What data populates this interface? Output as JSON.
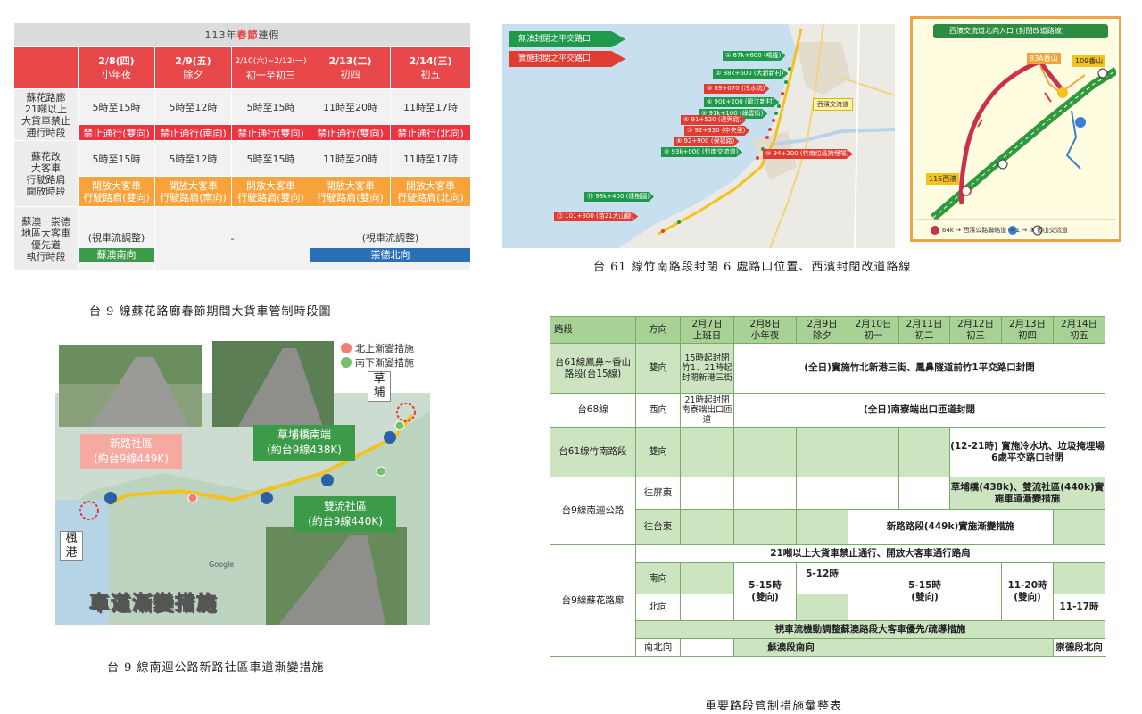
{
  "schedule": {
    "title_prefix": "113年",
    "title_highlight": "春節",
    "title_suffix": "連假",
    "days": [
      {
        "date": "2/8(四)",
        "name": "小年夜"
      },
      {
        "date": "2/9(五)",
        "name": "除夕"
      },
      {
        "date": "2/10(六)~2/12(一)",
        "name": "初一至初三"
      },
      {
        "date": "2/13(二)",
        "name": "初四"
      },
      {
        "date": "2/14(三)",
        "name": "初五"
      }
    ],
    "row1_label": "蘇花路廊\n21噸以上\n大貨車禁止\n通行時段",
    "row1_times": [
      "5時至15時",
      "5時至12時",
      "5時至15時",
      "11時至20時",
      "11時至17時"
    ],
    "row1_notes": [
      "禁止通行(雙向)",
      "禁止通行(南向)",
      "禁止通行(雙向)",
      "禁止通行(雙向)",
      "禁止通行(北向)"
    ],
    "row2_label": "蘇花改\n大客車\n行駛路肩\n開放時段",
    "row2_times": [
      "5時至15時",
      "5時至12時",
      "5時至15時",
      "11時至20時",
      "11時至17時"
    ],
    "row2_notes": [
      "開放大客車\n行駛路肩(雙向)",
      "開放大客車\n行駛路肩(南向)",
      "開放大客車\n行駛路肩(雙向)",
      "開放大客車\n行駛路肩(雙向)",
      "開放大客車\n行駛路肩(北向)"
    ],
    "row3_label": "蘇澳 · 崇德\n地區大客車\n優先道\n執行時段",
    "row3_left": "(視車流調整)",
    "row3_left_tag": "蘇澳南向",
    "row3_mid": "-",
    "row3_right": "(視車流調整)",
    "row3_right_tag": "崇德北向",
    "caption": "台 9 線蘇花路廊春節期間大貨車管制時段圖"
  },
  "map61": {
    "legend": [
      "無法封閉之平交路口",
      "實施封閉之平交路口"
    ],
    "sites": [
      {
        "label": "① 87k+600 (鳴隆)",
        "color": "g"
      },
      {
        "label": "② 88k+600 (大新新村)",
        "color": "g"
      },
      {
        "label": "③ 89+070 (冷水坑)",
        "color": "r"
      },
      {
        "label": "④ 90k+200 (龍江新村)",
        "color": "g"
      },
      {
        "label": "⑤ 91k+100 (綠雲街)",
        "color": "g"
      },
      {
        "label": "⑥ 91+520 (達興路)",
        "color": "r"
      },
      {
        "label": "⑦ 92+330 (中央里)",
        "color": "r"
      },
      {
        "label": "⑧ 92+900 (保福路)",
        "color": "r"
      },
      {
        "label": "⑨ 93k+000 (竹南交流道)",
        "color": "g"
      },
      {
        "label": "⑩ 94+200 (竹南垃圾掩埋場)",
        "color": "r"
      },
      {
        "label": "⑪ 98k+400 (達樹國)",
        "color": "g"
      },
      {
        "label": "⑫ 101+300 (苗21大山腳)",
        "color": "r"
      }
    ],
    "station": "西濱交流道",
    "caption": "台 61 線竹南路段封閉 6 處路口位置、西濱封閉改道路線"
  },
  "route": {
    "title": "西濱交流道北向入口 (封閉改道路線)",
    "road_83a": "83A香山",
    "road_109": "109香山",
    "road_116": "116西濱",
    "legend": "64k → 西濱公路聯絡道 → 1 → ③ 香山交流道"
  },
  "photo": {
    "legend_north": "北上漸變措施",
    "legend_south": "南下漸變措施",
    "place_caopu": "草\n埔",
    "place_fenggang": "楓\n港",
    "callout_xinlu": "新路社區\n(約台9線449K)",
    "callout_caopu": "草埔橋南端\n(約台9線438K)",
    "callout_shuangliu": "雙流社區\n(約台9線440K)",
    "banner": "車道漸變措施",
    "google": "Google",
    "caption": "台 9 線南迴公路新路社區車道漸變措施"
  },
  "summary": {
    "headers": [
      "路段",
      "方向",
      "2月7日\n上班日",
      "2月8日\n小年夜",
      "2月9日\n除夕",
      "2月10日\n初一",
      "2月11日\n初二",
      "2月12日\n初三",
      "2月13日\n初四",
      "2月14日\n初五"
    ],
    "r1_road": "台61線鳳鼻~香山路段(台15線)",
    "r1_dir": "雙向",
    "r1_feb7": "15時起封閉竹1、21時起封閉新港三街",
    "r1_rest": "(全日)實施竹北新港三街、鳳鼻隧道前竹1平交路口封閉",
    "r2_road": "台68線",
    "r2_dir": "西向",
    "r2_feb7": "21時起封閉南寮端出口匝道",
    "r2_rest": "(全日)南寮端出口匝道封閉",
    "r3_road": "台61線竹南路段",
    "r3_dir": "雙向",
    "r3_text": "(12-21時) 實施冷水坑、垃圾掩埋場6處平交路口封閉",
    "r4_road": "台9線南迴公路",
    "r4_dir1": "往屏東",
    "r4_text1": "草埔橋(438k)、雙流社區(440k)實施車道漸變措施",
    "r4_dir2": "往台東",
    "r4_text2": "新路路段(449k)實施漸變措施",
    "r5_road": "台9線蘇花路廊",
    "r5_header": "21噸以上大貨車禁止通行、開放大客車通行路肩",
    "r5_dir1": "南向",
    "r5_dir2": "北向",
    "r5_feb8": "5-15時\n(雙向)",
    "r5_feb9": "5-12時",
    "r5_mid": "5-15時\n(雙向)",
    "r5_feb13": "11-20時\n(雙向)",
    "r5_feb14": "11-17時",
    "r5_note": "視車流機動調整蘇澳路段大客車優先/疏導措施",
    "r5_dir3": "南北向",
    "r5_suao": "蘇澳段南向",
    "r5_chongde": "崇德段北向",
    "caption": "重要路段管制措施彙整表"
  }
}
